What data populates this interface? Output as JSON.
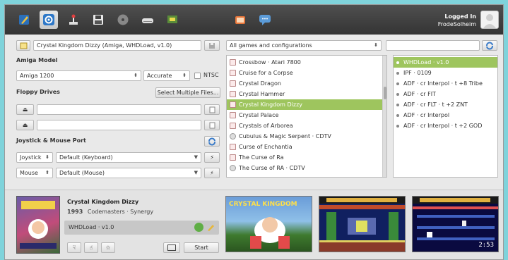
{
  "user": {
    "status": "Logged In",
    "name": "FrodeSolheim"
  },
  "config_name": "Crystal Kingdom Dizzy (Amiga, WHDLoad, v1.0)",
  "filter": {
    "selected": "All games and configurations",
    "search_value": ""
  },
  "amiga_model": {
    "heading": "Amiga Model",
    "model": "Amiga 1200",
    "accuracy": "Accurate",
    "ntsc_label": "NTSC"
  },
  "floppy": {
    "heading": "Floppy Drives",
    "select_multiple": "Select Multiple Files..."
  },
  "ports": {
    "heading": "Joystick & Mouse Port",
    "port1_type": "Joystick",
    "port1_device": "Default (Keyboard)",
    "port2_type": "Mouse",
    "port2_device": "Default (Mouse)"
  },
  "games": [
    "Crossbow · Atari 7800",
    "Cruise for a Corpse",
    "Crystal Dragon",
    "Crystal Hammer",
    "Crystal Kingdom Dizzy",
    "Crystal Palace",
    "Crystals of Arborea",
    "Cubulus & Magic Serpent · CDTV",
    "Curse of Enchantia",
    "The Curse of Ra",
    "The Curse of RA · CDTV"
  ],
  "variants": [
    "WHDLoad · v1.0",
    "IPF · 0109",
    "ADF · cr Interpol · t +8 Tribe",
    "ADF · cr FIT",
    "ADF · cr FLT · t +2 ZNT",
    "ADF · cr Interpol",
    "ADF · cr Interpol · t +2 GOD"
  ],
  "game_info": {
    "title": "Crystal Kingdom Dizzy",
    "year": "1993",
    "publishers": "Codemasters · Synergy",
    "variant": "WHDLoad · v1.0",
    "start": "Start"
  },
  "screenshots": {
    "title_text": "CRYSTAL KINGDOM",
    "timer": "2:53"
  },
  "colors": {
    "selection": "#9ec55e",
    "toolbar": "#404040",
    "background": "#7fd3db"
  }
}
